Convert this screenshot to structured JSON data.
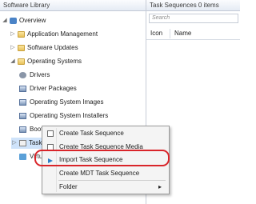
{
  "left": {
    "header": "Software Library",
    "tree": [
      {
        "label": "Overview",
        "icon": "overview-icon",
        "expanded": true
      },
      {
        "label": "Application Management",
        "icon": "folder-icon",
        "expanded": false
      },
      {
        "label": "Software Updates",
        "icon": "folder-icon",
        "expanded": false
      },
      {
        "label": "Operating Systems",
        "icon": "folder-icon",
        "expanded": true
      },
      {
        "label": "Drivers",
        "icon": "drivers-icon"
      },
      {
        "label": "Driver Packages",
        "icon": "driver-packages-icon"
      },
      {
        "label": "Operating System Images",
        "icon": "os-images-icon"
      },
      {
        "label": "Operating System Installers",
        "icon": "os-installers-icon"
      },
      {
        "label": "Boot Images",
        "icon": "boot-images-icon"
      },
      {
        "label": "Task S",
        "icon": "task-sequences-icon"
      },
      {
        "label": "Virtu",
        "icon": "virtual-hard-disks-icon"
      }
    ]
  },
  "right": {
    "header": "Task Sequences 0 items",
    "search_placeholder": "Search",
    "columns": [
      "Icon",
      "Name"
    ]
  },
  "context_menu": {
    "items": [
      {
        "label": "Create Task Sequence",
        "icon": "create-task-sequence-icon"
      },
      {
        "label": "Create Task Sequence Media",
        "icon": "create-media-icon"
      },
      {
        "label": "Import Task Sequence",
        "icon": "import-icon",
        "highlighted": true
      },
      {
        "label": "Create MDT Task Sequence",
        "icon": ""
      },
      {
        "label": "Folder",
        "icon": "",
        "submenu": true
      }
    ],
    "submenu_arrow": "▸"
  },
  "colors": {
    "highlight_ring": "#d9252a",
    "header_bg": "#e5ebf4"
  }
}
